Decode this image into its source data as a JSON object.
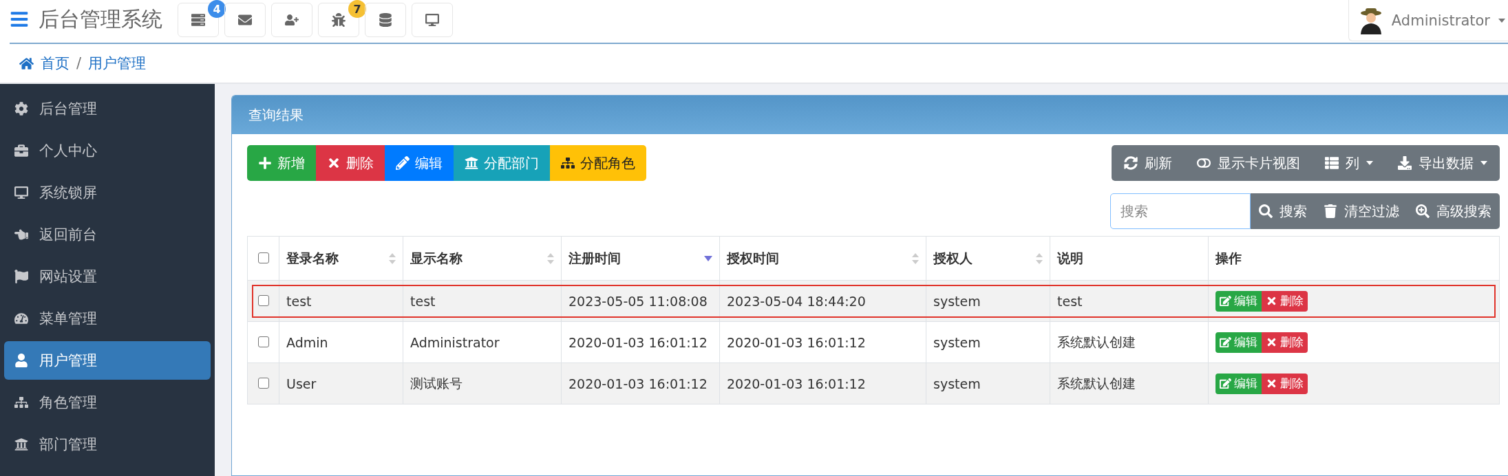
{
  "header": {
    "title": "后台管理系统",
    "icon_buttons": [
      {
        "kind": "server",
        "badge": "4",
        "color": "#3c8dea"
      },
      {
        "kind": "mail"
      },
      {
        "kind": "user-add"
      },
      {
        "kind": "bug",
        "badge": "7",
        "color": "#f5c033"
      },
      {
        "kind": "database"
      },
      {
        "kind": "monitor"
      }
    ],
    "user": "Administrator"
  },
  "breadcrumb": {
    "items": [
      "首页",
      "用户管理"
    ],
    "separator": "/"
  },
  "sidebar": {
    "items": [
      {
        "label": "后台管理",
        "selected": false
      },
      {
        "label": "个人中心",
        "selected": false
      },
      {
        "label": "系统锁屏",
        "selected": false
      },
      {
        "label": "返回前台",
        "selected": false
      },
      {
        "label": "网站设置",
        "selected": false
      },
      {
        "label": "菜单管理",
        "selected": false
      },
      {
        "label": "用户管理",
        "selected": true
      },
      {
        "label": "角色管理",
        "selected": false
      },
      {
        "label": "部门管理",
        "selected": false
      }
    ]
  },
  "panel": {
    "title": "查询结果",
    "actions": [
      {
        "label": "新增",
        "kind": "add"
      },
      {
        "label": "删除",
        "kind": "delete"
      },
      {
        "label": "编辑",
        "kind": "edit"
      },
      {
        "label": "分配部门",
        "kind": "dept"
      },
      {
        "label": "分配角色",
        "kind": "role"
      }
    ],
    "tools": [
      {
        "label": "刷新",
        "dropdown": false
      },
      {
        "label": "显示卡片视图",
        "dropdown": false
      },
      {
        "label": "列",
        "dropdown": true
      },
      {
        "label": "导出数据",
        "dropdown": true
      }
    ],
    "search": {
      "placeholder": "搜索"
    },
    "search_buttons": [
      "搜索",
      "清空过滤",
      "高级搜索"
    ]
  },
  "table": {
    "select_all_checked": false,
    "columns": [
      {
        "label": "登录名称",
        "sortable": true,
        "sorted": false
      },
      {
        "label": "显示名称",
        "sortable": true,
        "sorted": false
      },
      {
        "label": "注册时间",
        "sortable": true,
        "sorted": true
      },
      {
        "label": "授权时间",
        "sortable": true,
        "sorted": false
      },
      {
        "label": "授权人",
        "sortable": true,
        "sorted": false
      },
      {
        "label": "说明",
        "sortable": false
      },
      {
        "label": "操作",
        "sortable": false
      }
    ],
    "rows": [
      {
        "checked": false,
        "outlined": true,
        "cells": [
          "test",
          "test",
          "2023-05-05 11:08:08",
          "2023-05-04 18:44:20",
          "system",
          "test"
        ],
        "ops": [
          "编辑",
          "删除"
        ]
      },
      {
        "checked": false,
        "outlined": false,
        "cells": [
          "Admin",
          "Administrator",
          "2020-01-03 16:01:12",
          "2020-01-03 16:01:12",
          "system",
          "系统默认创建"
        ],
        "ops": [
          "编辑",
          "删除"
        ]
      },
      {
        "checked": false,
        "outlined": false,
        "cells": [
          "User",
          "测试账号",
          "2020-01-03 16:01:12",
          "2020-01-03 16:01:12",
          "system",
          "系统默认创建"
        ],
        "ops": [
          "编辑",
          "删除"
        ]
      }
    ]
  }
}
